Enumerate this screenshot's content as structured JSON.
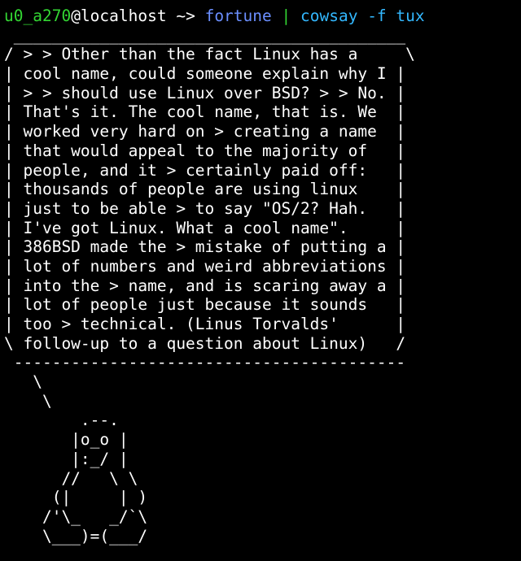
{
  "prompt": {
    "user": "u0_a270",
    "at": "@",
    "host": "localhost",
    "arrow": " ~> ",
    "cmd1": "fortune",
    "pipe": " | ",
    "cmd2": "cowsay",
    "args": " -f tux"
  },
  "output_lines": [
    " _________________________________________",
    "/ > > Other than the fact Linux has a     \\",
    "| cool name, could someone explain why I |",
    "| > > should use Linux over BSD? > > No. |",
    "| That's it. The cool name, that is. We  |",
    "| worked very hard on > creating a name  |",
    "| that would appeal to the majority of   |",
    "| people, and it > certainly paid off:   |",
    "| thousands of people are using linux    |",
    "| just to be able > to say \"OS/2? Hah.   |",
    "| I've got Linux. What a cool name\".     |",
    "| 386BSD made the > mistake of putting a |",
    "| lot of numbers and weird abbreviations |",
    "| into the > name, and is scaring away a |",
    "| lot of people just because it sounds   |",
    "| too > technical. (Linus Torvalds'      |",
    "\\ follow-up to a question about Linux)   /",
    " -----------------------------------------",
    "   \\",
    "    \\",
    "        .--.",
    "       |o_o |",
    "       |:_/ |",
    "      //   \\ \\",
    "     (|     | )",
    "    /'\\_   _/`\\",
    "    \\___)=(___/"
  ]
}
